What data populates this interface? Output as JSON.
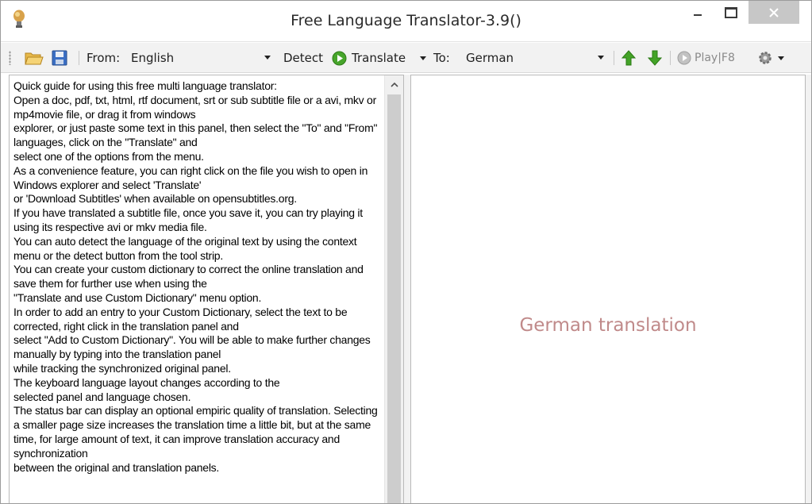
{
  "window": {
    "title": "Free Language Translator-3.9()"
  },
  "toolbar": {
    "from_label": "From:",
    "from_value": "English",
    "detect_label": "Detect",
    "translate_label": "Translate",
    "to_label": "To:",
    "to_value": "German",
    "play_label": "Play|F8",
    "icons": [
      "open-folder-icon",
      "save-disk-icon",
      "play-green-icon",
      "arrow-up-icon",
      "arrow-down-icon",
      "play-grey-icon",
      "gear-icon"
    ]
  },
  "source_panel": {
    "text": "Quick guide for using this free multi language translator:\nOpen a doc, pdf, txt, html, rtf document, srt or sub subtitle file or a avi, mkv or mp4movie file, or drag it from windows\nexplorer, or just paste some text in this panel, then select the \"To\" and \"From\" languages, click on the \"Translate\" and\nselect one of the options from the menu.\nAs a convenience feature, you can right click on the file you wish to open in Windows explorer and select 'Translate'\nor 'Download Subtitles' when available on opensubtitles.org.\nIf you have translated a subtitle file, once you save it, you can try playing it using its respective avi or mkv media file.\nYou can auto detect the language of the original text by using the context menu or the detect button from the tool strip.\nYou can create your custom dictionary to correct the online translation and save them for further use when using the\n\"Translate and use Custom Dictionary\" menu option.\nIn order to add an entry to your Custom Dictionary, select the text to be corrected, right click in the translation panel and\nselect \"Add to Custom Dictionary\". You will be able to make further changes manually by typing into the translation panel\nwhile tracking the synchronized original panel.\nThe keyboard language layout changes according to the\nselected panel and language chosen.\nThe status bar can display an optional empiric quality of translation. Selecting a smaller page size increases the translation time a little bit, but at the same time, for large amount of text, it can improve translation accuracy and synchronization\nbetween the original and translation panels."
  },
  "target_panel": {
    "placeholder": "German translation"
  },
  "colors": {
    "placeholder": "#c08a8a",
    "close_button": "#c7c7c7",
    "toolbar_bg": "#f2f2f2"
  }
}
